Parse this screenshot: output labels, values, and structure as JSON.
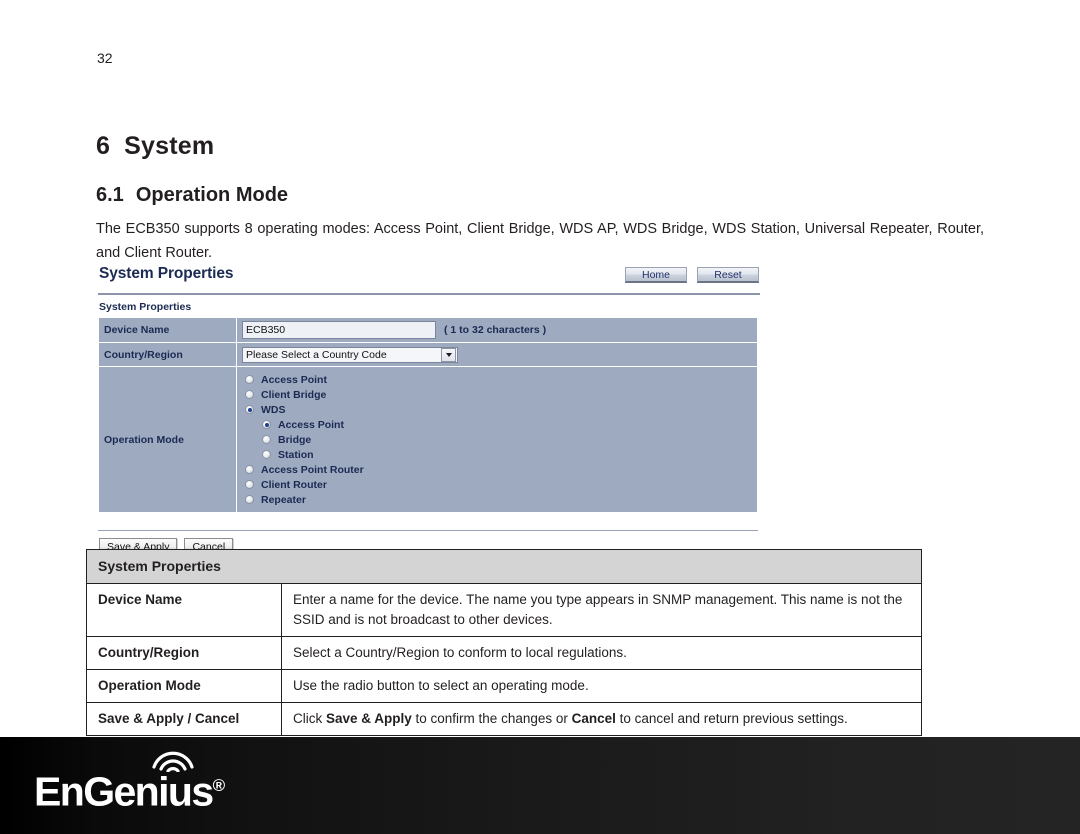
{
  "document": {
    "page_number": "32",
    "chapter": {
      "number": "6",
      "title": "System"
    },
    "section": {
      "number": "6.1",
      "title": "Operation Mode"
    },
    "paragraph": "The ECB350 supports 8 operating modes: Access Point, Client Bridge, WDS AP, WDS Bridge, WDS Station, Universal Repeater, Router, and Client Router."
  },
  "webui": {
    "title": "System Properties",
    "top_buttons": [
      {
        "label": "Home",
        "name": "home-button"
      },
      {
        "label": "Reset",
        "name": "reset-button"
      }
    ],
    "section_label": "System Properties",
    "device_name": {
      "label": "Device Name",
      "value": "ECB350",
      "hint": "( 1 to 32 characters )"
    },
    "country_region": {
      "label": "Country/Region",
      "selected": "Please Select a Country Code"
    },
    "operation_mode": {
      "label": "Operation Mode",
      "options": [
        {
          "label": "Access Point",
          "selected": false,
          "indent": false
        },
        {
          "label": "Client Bridge",
          "selected": false,
          "indent": false
        },
        {
          "label": "WDS",
          "selected": true,
          "indent": false
        },
        {
          "label": "Access Point",
          "selected": true,
          "indent": true
        },
        {
          "label": "Bridge",
          "selected": false,
          "indent": true
        },
        {
          "label": "Station",
          "selected": false,
          "indent": true
        },
        {
          "label": "Access Point Router",
          "selected": false,
          "indent": false
        },
        {
          "label": "Client Router",
          "selected": false,
          "indent": false
        },
        {
          "label": "Repeater",
          "selected": false,
          "indent": false
        }
      ]
    },
    "form_buttons": [
      {
        "label": "Save & Apply",
        "name": "save-apply-button"
      },
      {
        "label": "Cancel",
        "name": "cancel-button"
      }
    ]
  },
  "description_table": {
    "header": "System Properties",
    "rows": [
      {
        "term": "Device Name",
        "description": "Enter a name for the device. The name you type appears in SNMP management. This name is not the SSID and is not broadcast to other devices."
      },
      {
        "term": "Country/Region",
        "description": "Select a Country/Region to conform to local regulations."
      },
      {
        "term": "Operation Mode",
        "description": "Use the radio button to select an operating mode."
      },
      {
        "term": "Save & Apply / Cancel",
        "description_parts": {
          "p1": "Click ",
          "b1": "Save & Apply",
          "p2": " to confirm the changes or ",
          "b2": "Cancel",
          "p3": " to cancel and return previous settings."
        }
      }
    ]
  },
  "footer": {
    "brand": "EnGenius",
    "registered_mark": "®"
  }
}
